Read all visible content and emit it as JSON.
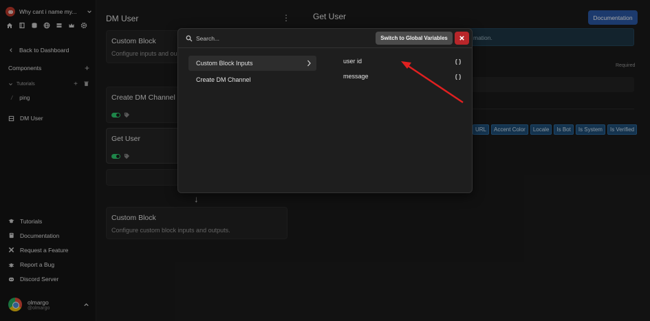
{
  "sidebar": {
    "server_name": "Why cant i name my...",
    "back_label": "Back to Dashboard",
    "components_label": "Components",
    "tutorials_folder_label": "Tutorials",
    "ping_label": "ping",
    "dm_user_label": "DM User",
    "bottom_items": [
      {
        "label": "Tutorials",
        "icon": "graduation-cap-icon"
      },
      {
        "label": "Documentation",
        "icon": "book-icon"
      },
      {
        "label": "Request a Feature",
        "icon": "tools-icon"
      },
      {
        "label": "Report a Bug",
        "icon": "bug-icon"
      },
      {
        "label": "Discord Server",
        "icon": "discord-icon"
      }
    ],
    "user": {
      "name": "olmargo",
      "handle": "@olmargo"
    }
  },
  "left_pane": {
    "title": "DM User",
    "top_card_title": "Custom Block",
    "top_card_subtitle": "Configure inputs and ou",
    "create_dm_title": "Create DM Channel",
    "get_user_title": "Get User",
    "bottom_card_title": "Custom Block",
    "bottom_card_subtitle": "Configure custom block inputs and outputs."
  },
  "right_pane": {
    "title": "Get User",
    "documentation_label": "Documentation",
    "info_text": "mation.",
    "required_label": "Required",
    "chips": [
      "URL",
      "Accent Color",
      "Locale",
      "Is Bot",
      "Is System",
      "Is Verified"
    ]
  },
  "popup": {
    "search_placeholder": "Search...",
    "global_button": "Switch to Global Variables",
    "menu": [
      {
        "label": "Custom Block Inputs",
        "active": true
      },
      {
        "label": "Create DM Channel",
        "active": false
      }
    ],
    "variables": [
      {
        "label": "user id"
      },
      {
        "label": "message"
      }
    ]
  },
  "colors": {
    "accent_blue": "#2b5aa8",
    "close_red": "#b8262a",
    "toggle_green": "#2ecc71",
    "annotation_arrow": "#e02020"
  }
}
